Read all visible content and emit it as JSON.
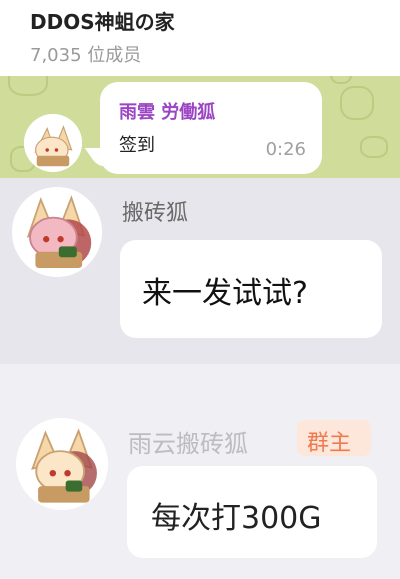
{
  "header": {
    "title": "DDOS神蛆の家",
    "member_count": "7,035 位成员"
  },
  "messages": [
    {
      "sender": "雨雲 労働狐",
      "text": "签到",
      "time": "0:26",
      "avatar_icon": "fox-girl-avatar-icon"
    },
    {
      "sender": "搬砖狐",
      "text": "来一发试试?",
      "avatar_icon": "fox-girl-avatar-icon"
    },
    {
      "sender": "雨云搬砖狐",
      "badge": "群主",
      "text": "每次打300G",
      "avatar_icon": "fox-girl-avatar-icon"
    }
  ],
  "colors": {
    "wallpaper": "#cfdc9a",
    "sender_purple": "#9b44c4",
    "badge_bg": "#fde7da",
    "badge_text": "#f07a4e"
  }
}
